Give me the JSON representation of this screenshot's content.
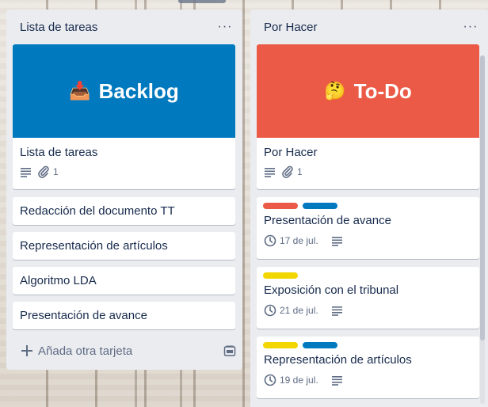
{
  "lists": [
    {
      "title": "Lista de tareas",
      "cover": {
        "emoji": "📥",
        "text": "Backlog",
        "color": "#0079bf"
      },
      "cover_card": {
        "title": "Lista de tareas",
        "attachments": "1"
      },
      "cards": [
        {
          "title": "Redacción del documento TT"
        },
        {
          "title": "Representación de artículos"
        },
        {
          "title": "Algoritmo LDA"
        },
        {
          "title": "Presentación de avance"
        }
      ],
      "add_card_label": "Añada otra tarjeta"
    },
    {
      "title": "Por Hacer",
      "cover": {
        "emoji": "🤔",
        "text": "To-Do",
        "color": "#eb5a46"
      },
      "cover_card": {
        "title": "Por Hacer",
        "attachments": "1"
      },
      "cards": [
        {
          "title": "Presentación de avance",
          "labels": [
            "#eb5a46",
            "#0079bf"
          ],
          "due": "17 de jul."
        },
        {
          "title": "Exposición con el tribunal",
          "labels": [
            "#f2d600"
          ],
          "due": "21 de jul."
        },
        {
          "title": "Representación de artículos",
          "labels": [
            "#f2d600",
            "#0079bf"
          ],
          "due": "19 de jul."
        }
      ]
    }
  ],
  "icons": {
    "menu": "ellipsis-icon",
    "description": "description-lines-icon",
    "attachment": "paperclip-icon",
    "due": "clock-icon",
    "add": "plus-icon",
    "template": "card-template-icon"
  }
}
